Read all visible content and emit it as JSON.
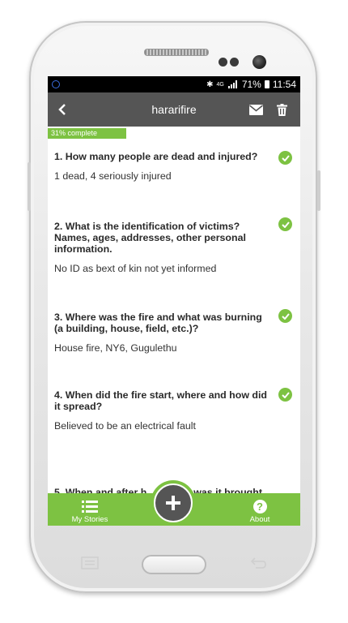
{
  "status": {
    "network": "4G",
    "battery_percent": "71%",
    "time": "11:54"
  },
  "header": {
    "title": "hararifire"
  },
  "progress": {
    "label": "31% complete",
    "fraction": 0.31
  },
  "questions": [
    {
      "q": "1. How many people are dead and injured?",
      "a": "1 dead, 4 seriously injured"
    },
    {
      "q": "2. What is the identification of victims? Names, ages, addresses, other personal information.",
      "a": "No ID as bext of kin not yet informed"
    },
    {
      "q": "3. Where was the fire and what was burning (a building, house, field, etc.)?",
      "a": "House fire, NY6, Gugulethu"
    },
    {
      "q": "4. When did the fire start, where and how did it spread?",
      "a": "Believed to be an electrical fault"
    }
  ],
  "partial_question": {
    "text": "5. When and after h",
    "text_tail": "was it brought"
  },
  "bottom_nav": {
    "my_stories": "My Stories",
    "about": "About"
  },
  "colors": {
    "accent": "#7dc242",
    "toolbar": "#555555"
  },
  "icons": [
    "back-arrow-icon",
    "mail-icon",
    "trash-icon",
    "check-icon",
    "list-icon",
    "plus-icon",
    "help-icon"
  ]
}
